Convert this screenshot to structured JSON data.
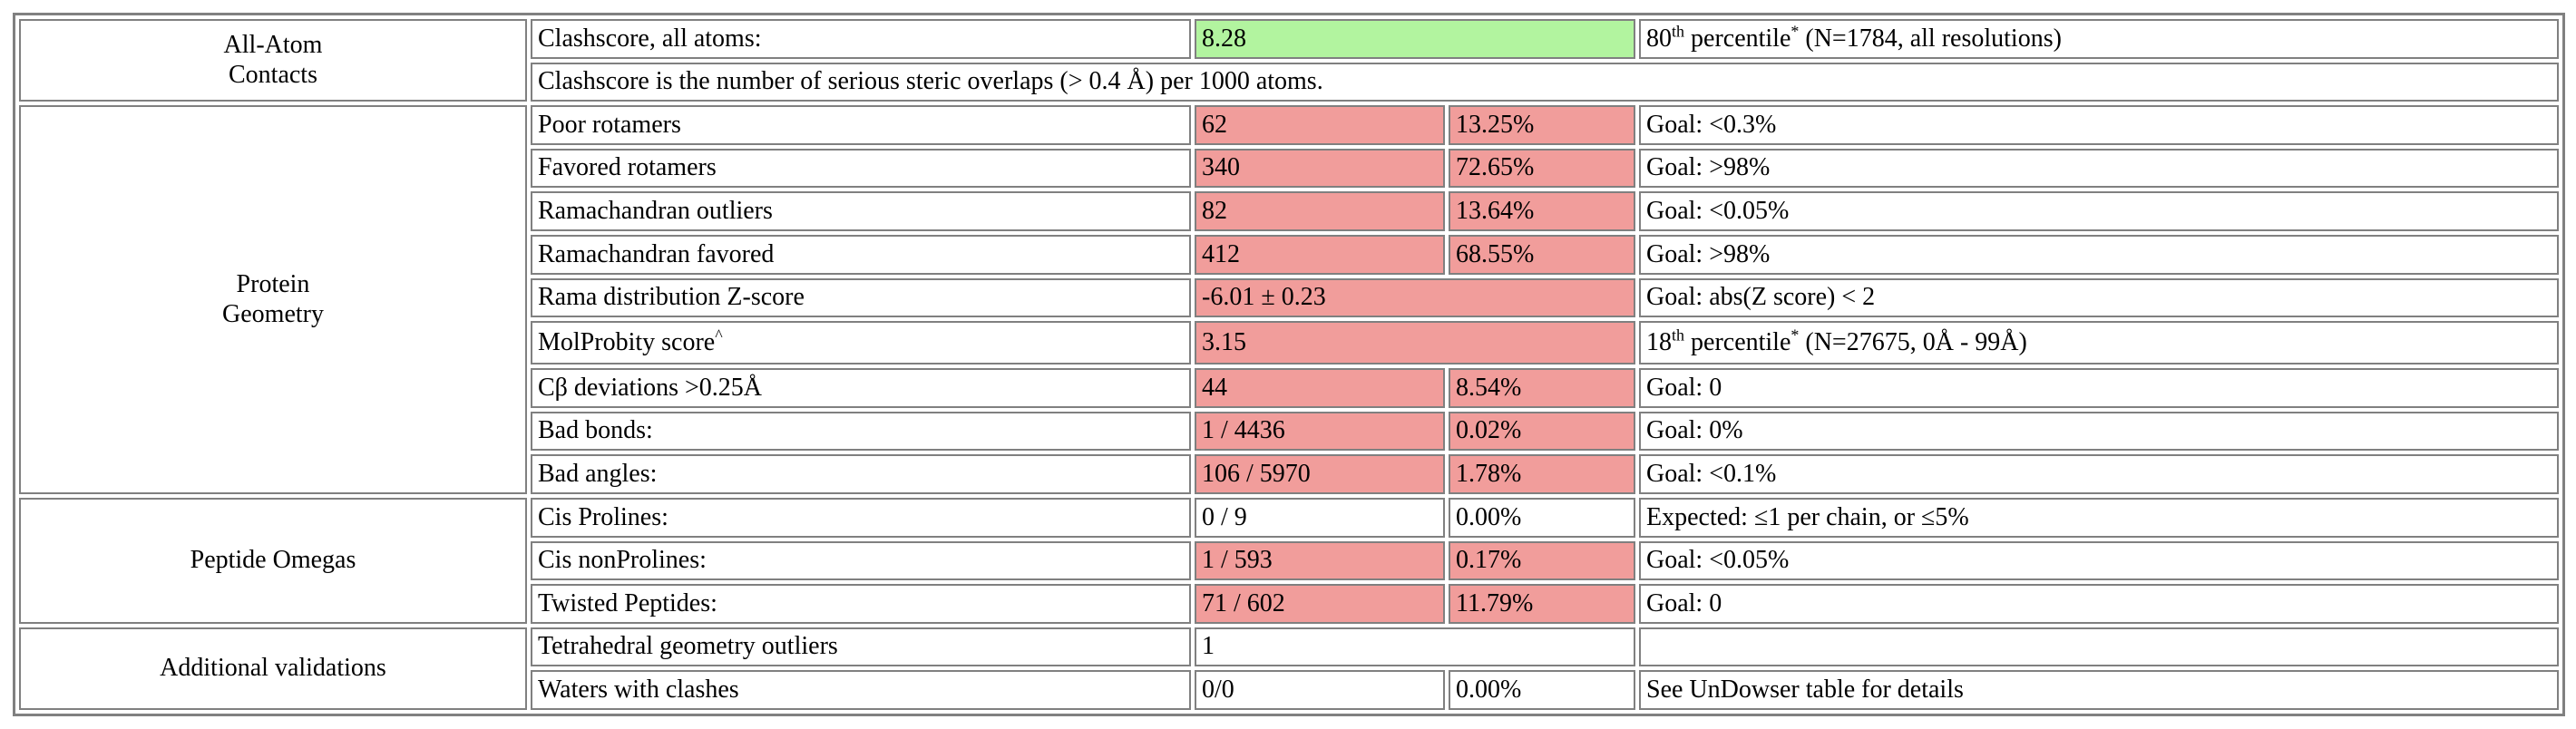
{
  "sections": {
    "contacts": [
      "All-Atom",
      "Contacts"
    ],
    "geometry": [
      "Protein",
      "Geometry"
    ],
    "omegas": "Peptide Omegas",
    "additional": "Additional validations"
  },
  "clashscore": {
    "label": "Clashscore, all atoms:",
    "value": "8.28",
    "pct_num": "80",
    "pct_sup": "th",
    "pct_text": " percentile",
    "pct_star": "*",
    "pct_tail": " (N=1784, all resolutions)",
    "note": "Clashscore is the number of serious steric overlaps (> 0.4 Å) per 1000 atoms."
  },
  "geometry_rows": [
    {
      "label": "Poor rotamers",
      "count": "62",
      "pct": "13.25%",
      "goal": "Goal: <0.3%"
    },
    {
      "label": "Favored rotamers",
      "count": "340",
      "pct": "72.65%",
      "goal": "Goal: >98%"
    },
    {
      "label": "Ramachandran outliers",
      "count": "82",
      "pct": "13.64%",
      "goal": "Goal: <0.05%"
    },
    {
      "label": "Ramachandran favored",
      "count": "412",
      "pct": "68.55%",
      "goal": "Goal: >98%"
    }
  ],
  "rama_z": {
    "label": "Rama distribution Z-score",
    "value": "-6.01 ± 0.23",
    "goal": "Goal: abs(Z score) < 2"
  },
  "molprobity": {
    "label": "MolProbity score",
    "label_sup": "^",
    "value": "3.15",
    "pct_num": "18",
    "pct_sup": "th",
    "pct_text": " percentile",
    "pct_star": "*",
    "pct_tail": " (N=27675, 0Å - 99Å)"
  },
  "geometry_rows2": [
    {
      "label": "Cβ deviations >0.25Å",
      "count": "44",
      "pct": "8.54%",
      "goal": "Goal: 0"
    },
    {
      "label": "Bad bonds:",
      "count": "1 / 4436",
      "pct": "0.02%",
      "goal": "Goal: 0%"
    },
    {
      "label": "Bad angles:",
      "count": "106 / 5970",
      "pct": "1.78%",
      "goal": "Goal: <0.1%"
    }
  ],
  "omega_rows": [
    {
      "label": "Cis Prolines:",
      "count": "0 / 9",
      "pct": "0.00%",
      "goal": "Expected: ≤1 per chain, or ≤5%"
    },
    {
      "label": "Cis nonProlines:",
      "count": "1 / 593",
      "pct": "0.17%",
      "goal": "Goal: <0.05%"
    },
    {
      "label": "Twisted Peptides:",
      "count": "71 / 602",
      "pct": "11.79%",
      "goal": "Goal: 0"
    }
  ],
  "additional_rows": {
    "tetra": {
      "label": "Tetrahedral geometry outliers",
      "value": "1"
    },
    "waters": {
      "label": "Waters with clashes",
      "count": "0/0",
      "pct": "0.00%",
      "goal": "See UnDowser table for details"
    }
  },
  "colors": {
    "bad": "#f19d9b",
    "good": "#b2f49f",
    "border": "#808080"
  }
}
